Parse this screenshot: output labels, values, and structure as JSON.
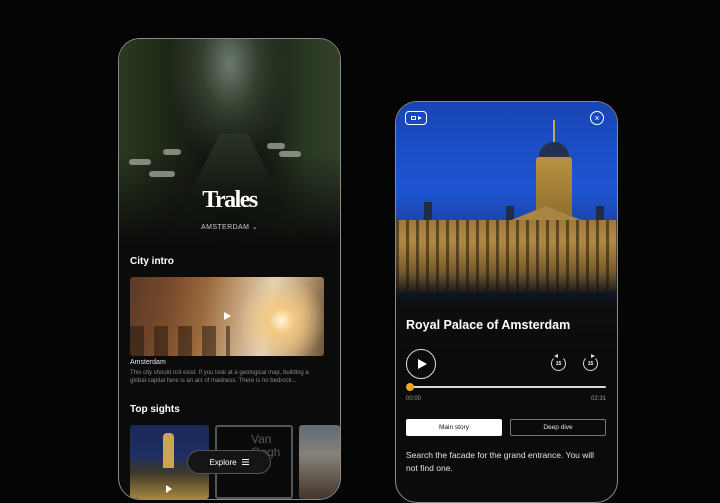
{
  "city_guide": {
    "logo": "Trales",
    "city_selector": "AMSTERDAM",
    "city_intro_heading": "City intro",
    "intro_card": {
      "name": "Amsterdam",
      "description": "This city should not exist. If you look at a geological map, building a global capital here is an act of madness. There is no bedrock..."
    },
    "top_sights_heading": "Top sights",
    "top_sights": [
      {
        "image": "royal-palace-night"
      },
      {
        "image": "van-gogh-museum",
        "text": "Van Gogh"
      },
      {
        "image": "canal-houses"
      }
    ],
    "explore_label": "Explore"
  },
  "player": {
    "title": "Royal Palace of Amsterdam",
    "progress": 0.0,
    "time_current": "00:00",
    "time_total": "02:31",
    "rewind_label": "15",
    "forward_label": "15",
    "tabs": [
      {
        "label": "Main story",
        "active": true
      },
      {
        "label": "Deep dive",
        "active": false
      }
    ],
    "story_text": "Search the facade for the grand entrance. You will not find one."
  },
  "colors": {
    "accent": "#f0a91c",
    "background": "#050505",
    "sky": "#1f55d2"
  }
}
